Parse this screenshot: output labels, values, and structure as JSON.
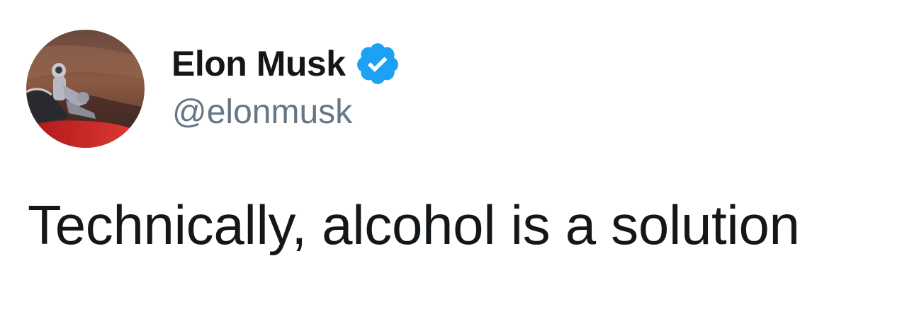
{
  "tweet": {
    "author": {
      "display_name": "Elon Musk",
      "handle": "@elonmusk",
      "verified": true
    },
    "text": "Technically, alcohol is a solution"
  },
  "icons": {
    "verified_badge": "verified-badge-icon",
    "avatar": "profile-photo"
  },
  "colors": {
    "verified_blue": "#1da1f2",
    "name": "#14171a",
    "handle": "#657786",
    "text": "#14171a",
    "background": "#ffffff"
  }
}
